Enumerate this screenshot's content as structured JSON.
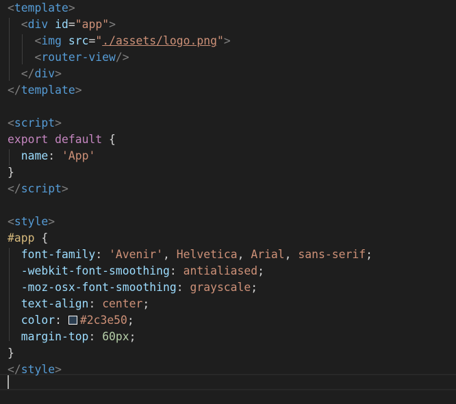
{
  "editor": {
    "language": "vue",
    "lines": [
      {
        "indent": "",
        "tokens": [
          [
            "punct",
            "<"
          ],
          [
            "tag",
            "template"
          ],
          [
            "punct",
            ">"
          ]
        ]
      },
      {
        "indent": "  ",
        "tokens": [
          [
            "punct",
            "<"
          ],
          [
            "tag",
            "div"
          ],
          [
            "plain",
            " "
          ],
          [
            "attr",
            "id"
          ],
          [
            "plain",
            "="
          ],
          [
            "str",
            "\"app\""
          ],
          [
            "punct",
            ">"
          ]
        ]
      },
      {
        "indent": "    ",
        "tokens": [
          [
            "punct",
            "<"
          ],
          [
            "tag",
            "img"
          ],
          [
            "plain",
            " "
          ],
          [
            "attr",
            "src"
          ],
          [
            "plain",
            "="
          ],
          [
            "str",
            "\""
          ],
          [
            "link",
            "./assets/logo.png"
          ],
          [
            "str",
            "\""
          ],
          [
            "punct",
            ">"
          ]
        ]
      },
      {
        "indent": "    ",
        "tokens": [
          [
            "punct",
            "<"
          ],
          [
            "tag",
            "router-view"
          ],
          [
            "punct",
            "/>"
          ]
        ]
      },
      {
        "indent": "  ",
        "tokens": [
          [
            "punct",
            "</"
          ],
          [
            "tag",
            "div"
          ],
          [
            "punct",
            ">"
          ]
        ]
      },
      {
        "indent": "",
        "tokens": [
          [
            "punct",
            "</"
          ],
          [
            "tag",
            "template"
          ],
          [
            "punct",
            ">"
          ]
        ]
      },
      {
        "indent": "",
        "tokens": []
      },
      {
        "indent": "",
        "tokens": [
          [
            "punct",
            "<"
          ],
          [
            "tag",
            "script"
          ],
          [
            "punct",
            ">"
          ]
        ]
      },
      {
        "indent": "",
        "tokens": [
          [
            "kw",
            "export"
          ],
          [
            "plain",
            " "
          ],
          [
            "kw",
            "default"
          ],
          [
            "plain",
            " {"
          ]
        ]
      },
      {
        "indent": "  ",
        "tokens": [
          [
            "attr",
            "name"
          ],
          [
            "plain",
            ": "
          ],
          [
            "str",
            "'App'"
          ]
        ]
      },
      {
        "indent": "",
        "tokens": [
          [
            "plain",
            "}"
          ]
        ]
      },
      {
        "indent": "",
        "tokens": [
          [
            "punct",
            "</"
          ],
          [
            "tag",
            "script"
          ],
          [
            "punct",
            ">"
          ]
        ]
      },
      {
        "indent": "",
        "tokens": []
      },
      {
        "indent": "",
        "tokens": [
          [
            "punct",
            "<"
          ],
          [
            "tag",
            "style"
          ],
          [
            "punct",
            ">"
          ]
        ]
      },
      {
        "indent": "",
        "tokens": [
          [
            "sel",
            "#app"
          ],
          [
            "plain",
            " {"
          ]
        ]
      },
      {
        "indent": "  ",
        "tokens": [
          [
            "attr",
            "font-family"
          ],
          [
            "plain",
            ": "
          ],
          [
            "str",
            "'Avenir'"
          ],
          [
            "plain",
            ", "
          ],
          [
            "str",
            "Helvetica"
          ],
          [
            "plain",
            ", "
          ],
          [
            "str",
            "Arial"
          ],
          [
            "plain",
            ", "
          ],
          [
            "str",
            "sans-serif"
          ],
          [
            "plain",
            ";"
          ]
        ]
      },
      {
        "indent": "  ",
        "tokens": [
          [
            "attr",
            "-webkit-font-smoothing"
          ],
          [
            "plain",
            ": "
          ],
          [
            "str",
            "antialiased"
          ],
          [
            "plain",
            ";"
          ]
        ]
      },
      {
        "indent": "  ",
        "tokens": [
          [
            "attr",
            "-moz-osx-font-smoothing"
          ],
          [
            "plain",
            ": "
          ],
          [
            "str",
            "grayscale"
          ],
          [
            "plain",
            ";"
          ]
        ]
      },
      {
        "indent": "  ",
        "tokens": [
          [
            "attr",
            "text-align"
          ],
          [
            "plain",
            ": "
          ],
          [
            "str",
            "center"
          ],
          [
            "plain",
            ";"
          ]
        ]
      },
      {
        "indent": "  ",
        "tokens": [
          [
            "attr",
            "color"
          ],
          [
            "plain",
            ": "
          ],
          [
            "swatch",
            ""
          ],
          [
            "str",
            "#2c3e50"
          ],
          [
            "plain",
            ";"
          ]
        ]
      },
      {
        "indent": "  ",
        "tokens": [
          [
            "attr",
            "margin-top"
          ],
          [
            "plain",
            ": "
          ],
          [
            "num",
            "60px"
          ],
          [
            "plain",
            ";"
          ]
        ]
      },
      {
        "indent": "",
        "tokens": [
          [
            "plain",
            "}"
          ]
        ]
      },
      {
        "indent": "",
        "tokens": [
          [
            "punct",
            "</"
          ],
          [
            "tag",
            "style"
          ],
          [
            "punct",
            ">"
          ]
        ]
      },
      {
        "indent": "",
        "tokens": []
      }
    ],
    "color_swatch": "#2c3e50"
  },
  "colors": {
    "background": "#1e1e1e",
    "tag": "#569cd6",
    "attribute": "#9cdcfe",
    "string": "#ce9178",
    "keyword": "#c586c0",
    "number": "#b5cea8",
    "selector": "#d7ba7d",
    "punctuation": "#808080"
  }
}
